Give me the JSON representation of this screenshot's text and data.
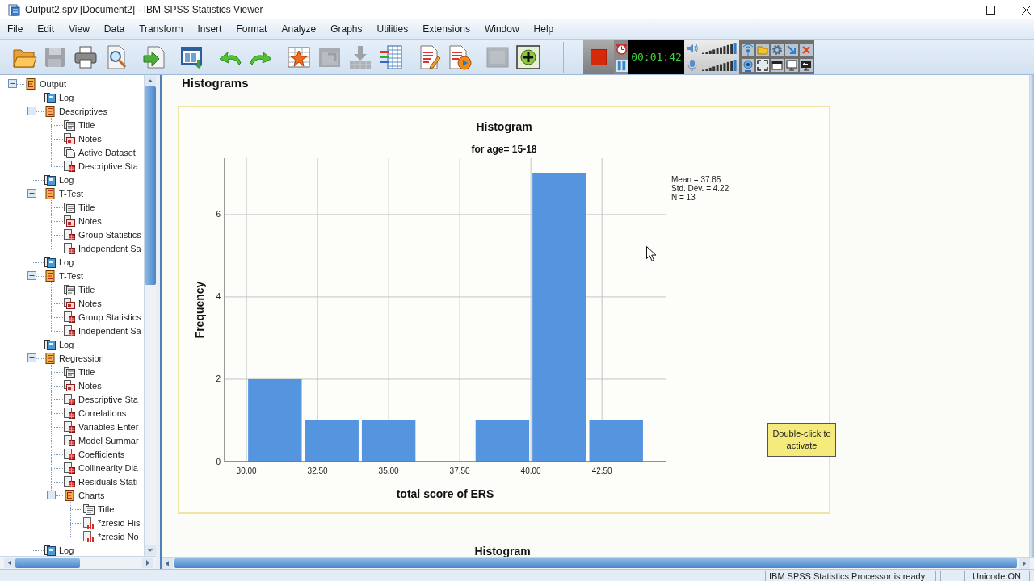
{
  "window": {
    "title": "Output2.spv [Document2] - IBM SPSS Statistics Viewer"
  },
  "menu": [
    "File",
    "Edit",
    "View",
    "Data",
    "Transform",
    "Insert",
    "Format",
    "Analyze",
    "Graphs",
    "Utilities",
    "Extensions",
    "Window",
    "Help"
  ],
  "toolbar": {
    "groups": [
      [
        {
          "kind": "open",
          "disabled": false
        },
        {
          "kind": "save",
          "disabled": true
        },
        {
          "kind": "print",
          "disabled": false
        },
        {
          "kind": "preview",
          "disabled": false
        }
      ],
      [
        {
          "kind": "export",
          "disabled": false
        }
      ],
      [
        {
          "kind": "data_editor",
          "disabled": false
        }
      ],
      [
        {
          "kind": "undo",
          "disabled": false
        },
        {
          "kind": "redo",
          "disabled": false
        }
      ],
      [
        {
          "kind": "goto",
          "disabled": false
        },
        {
          "kind": "insert_window",
          "disabled": true
        },
        {
          "kind": "insert_below",
          "disabled": true
        },
        {
          "kind": "variables",
          "disabled": false
        }
      ],
      [
        {
          "kind": "edit_page",
          "disabled": false
        },
        {
          "kind": "run_page",
          "disabled": false
        }
      ],
      [
        {
          "kind": "blank",
          "disabled": true
        },
        {
          "kind": "add",
          "disabled": false
        }
      ]
    ]
  },
  "recorder": {
    "timer": "00:01:42"
  },
  "tree": [
    {
      "label": "Output",
      "kind": "folder",
      "expanded": true,
      "children": [
        {
          "label": "Log",
          "kind": "log"
        },
        {
          "label": "Descriptives",
          "kind": "folder",
          "expanded": true,
          "children": [
            {
              "label": "Title",
              "kind": "title"
            },
            {
              "label": "Notes",
              "kind": "notes"
            },
            {
              "label": "Active Dataset",
              "kind": "dataset"
            },
            {
              "label": "Descriptive Sta",
              "kind": "table"
            }
          ]
        },
        {
          "label": "Log",
          "kind": "log"
        },
        {
          "label": "T-Test",
          "kind": "folder",
          "expanded": true,
          "children": [
            {
              "label": "Title",
              "kind": "title"
            },
            {
              "label": "Notes",
              "kind": "notes"
            },
            {
              "label": "Group Statistics",
              "kind": "table"
            },
            {
              "label": "Independent Sa",
              "kind": "table"
            }
          ]
        },
        {
          "label": "Log",
          "kind": "log"
        },
        {
          "label": "T-Test",
          "kind": "folder",
          "expanded": true,
          "children": [
            {
              "label": "Title",
              "kind": "title"
            },
            {
              "label": "Notes",
              "kind": "notes"
            },
            {
              "label": "Group Statistics",
              "kind": "table"
            },
            {
              "label": "Independent Sa",
              "kind": "table"
            }
          ]
        },
        {
          "label": "Log",
          "kind": "log"
        },
        {
          "label": "Regression",
          "kind": "folder",
          "expanded": true,
          "children": [
            {
              "label": "Title",
              "kind": "title"
            },
            {
              "label": "Notes",
              "kind": "notes"
            },
            {
              "label": "Descriptive Sta",
              "kind": "table"
            },
            {
              "label": "Correlations",
              "kind": "table"
            },
            {
              "label": "Variables Enter",
              "kind": "table"
            },
            {
              "label": "Model Summar",
              "kind": "table"
            },
            {
              "label": "Coefficients",
              "kind": "table"
            },
            {
              "label": "Collinearity Dia",
              "kind": "table"
            },
            {
              "label": "Residuals Stati",
              "kind": "table"
            },
            {
              "label": "Charts",
              "kind": "folder",
              "expanded": true,
              "children": [
                {
                  "label": "Title",
                  "kind": "title"
                },
                {
                  "label": "*zresid His",
                  "kind": "chart"
                },
                {
                  "label": "*zresid No",
                  "kind": "chart"
                }
              ]
            }
          ]
        },
        {
          "label": "Log",
          "kind": "log"
        }
      ]
    }
  ],
  "viewer": {
    "heading": "Histograms",
    "charts": [
      {
        "subtitle": "for age= 15-18",
        "legend": [
          "Mean = 37.85",
          "Std. Dev. = 4.22",
          "N = 13"
        ],
        "chart_data": {
          "type": "bar",
          "title": "Histogram",
          "xlabel": "total score of ERS",
          "ylabel": "Frequency",
          "x": [
            31,
            33,
            35,
            39,
            41,
            43
          ],
          "values": [
            2,
            1,
            1,
            1,
            7,
            1
          ],
          "xlim": [
            29.23,
            44.74
          ],
          "ylim": [
            0,
            7.37
          ],
          "xticks": [
            {
              "value": 30,
              "label": "30.00"
            },
            {
              "value": 32.5,
              "label": "32.50"
            },
            {
              "value": 35,
              "label": "35.00"
            },
            {
              "value": 37.5,
              "label": "37.50"
            },
            {
              "value": 40,
              "label": "40.00"
            },
            {
              "value": 42.5,
              "label": "42.50"
            }
          ],
          "yticks": [
            0,
            2,
            4,
            6
          ],
          "grid": true
        }
      }
    ],
    "tooltip": "Double-click to activate",
    "next_title": "Histogram"
  },
  "status_bar": {
    "message": "IBM SPSS Statistics Processor is ready",
    "encoding": "Unicode:ON"
  }
}
